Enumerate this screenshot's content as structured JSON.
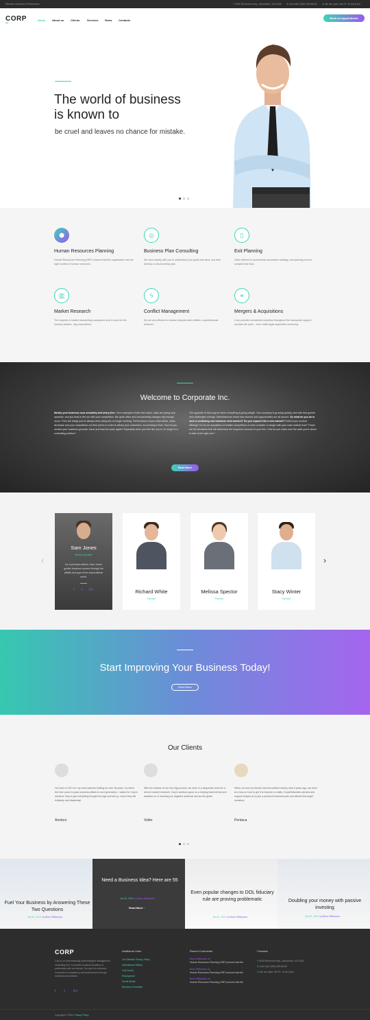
{
  "topbar": {
    "tagline": "Effective Business Performance",
    "address": "9026 Richmond Hwy., Alexandria, VA 22302",
    "phone": "Let's talk: (954) 399-86-82",
    "hours": "We are open:  Mn-Fr: 10 am-8 pm"
  },
  "nav": {
    "logo": "CORP",
    "items": [
      "Home",
      "About us",
      "Clients",
      "Services",
      "News",
      "Contacts"
    ],
    "cta": "Book an Appointment"
  },
  "hero": {
    "title_line1": "The world of business",
    "title_line2": "is known to",
    "subtitle": "be cruel and leaves no chance for mistake."
  },
  "services": [
    {
      "title": "Human Resources Planning",
      "text": "Human Resources Planning (HRP) ensures that the organization has the right number of human resources.",
      "icon": "network-icon"
    },
    {
      "title": "Business Plan Consulting",
      "text": "We work closely with you to understand your goals and aims, and then develop a new business plan.",
      "icon": "target-icon"
    },
    {
      "title": "Exit Planning",
      "text": "Often referred to as business succession strategy, exit planning is more complex than that.",
      "icon": "door-icon"
    },
    {
      "title": "Market Research",
      "text": "The majority of market researching companies tend to work for the industry leaders - big corporations.",
      "icon": "chart-icon"
    },
    {
      "title": "Conflict Management",
      "text": "It's not very efficient to resolve disputes with childish, unprofessional behavior.",
      "icon": "bolt-icon"
    },
    {
      "title": "Mergers & Acquisitions",
      "text": "Corp provides unmatched expertise throughout the transaction support services life cycle – from initial target acquisition screening.",
      "icon": "merge-icon"
    }
  ],
  "welcome": {
    "title": "Welcome to Corporate Inc.",
    "col1_bold": "Mostly your business runs smoothly and worry-free.",
    "col1": " Your employees finish their tasks, sales are going only upwards, and you lead in the run with your competition. But quite often and unexpectedly changes big enough occur. Then the things you've always been doing are no longer working. Performance of your team fades, sales decrease and your competitors cut their prices in order to attract your customers, succeeding in that. How do you reclaim your business grounds, focus and lead the pack again? Especially when you feel like you're no longer in a controlling position?",
    "col2a": "The opposite of that may be when everything is going alright. Your company is growing quickly, and with that growth new challenges emerge. Miscellaneous brand new choices and opportunities are all around. ",
    "col2_bold": "So what do you do in such a confusing new business environment? Do you expand into a new market?",
    "col2b": " Extend your product offering? Go for an acquisition of smaller competitors or even consider a merger with your main market rival? These are the decisions that will determine the long-term success of your firm. How do you make sure the path you're about to take is the right one?",
    "button": "Read More"
  },
  "team": {
    "members": [
      {
        "name": "Sam Jones",
        "role": "Senior partner",
        "bio": "As a principal advisor, Sam Jones guides business owners through the pitfalls and joys of the corporational world."
      },
      {
        "name": "Richard White",
        "role": "Partner"
      },
      {
        "name": "Melissa Spector",
        "role": "Partner"
      },
      {
        "name": "Stacy Winter",
        "role": "Partner"
      }
    ],
    "social": [
      "f",
      "t",
      "G+"
    ]
  },
  "banner": {
    "title": "Start Improving Your Business Today!",
    "button": "Read More"
  },
  "clients": {
    "title": "Our Clients",
    "items": [
      {
        "name": "Anotoro",
        "text": "I've been a CEO for my multi-national holding for over 48 years. So when the time came to pass business affairs to next generation, I asked for Corp's advisors' help to get everything thought through and set up, which they did brilliantly and flawlessly!"
      },
      {
        "name": "Volter",
        "text": "With the release of our new big product, we were in a desperate need for a decent market research. Corp's advisors gave us a helping hand at that and assisted us in reaching our targeted audience across the globe."
      },
      {
        "name": "Pentaca",
        "text": "When me and my friends had this brilliant startup idea 5 years ago, we were at a loss on how to get it to become a reality. CorpsRational's advices and support helped us to join a profound business plan and attract first angel investors."
      }
    ]
  },
  "blog": [
    {
      "title": "Fuel Your Business by Answering These Two Questions",
      "date": "Jan 20, 2016",
      "by": "by Brian Williamson"
    },
    {
      "title": "Need a Business Idea? Here are 55",
      "date": "Jan 20, 2016",
      "by": "by Brian Williamson",
      "more": "Read More"
    },
    {
      "title": "Even popular changes to DOL fiduciary rule are proving problematic",
      "date": "Jan 20, 2016",
      "by": "by Brian Williamson"
    },
    {
      "title": "Doubling your money with passive investing",
      "date": "Jan 20, 2016",
      "by": "by Brian Williamson"
    }
  ],
  "footer": {
    "logo": "CORP",
    "about": "Corp is an internationally acknowledged management consulting firm. It provides localized solutions in partnership with our clients. Our aim is to enhance Corporate's competency and performance through result-based solutions.",
    "links_title": "Additional Links",
    "links": [
      "Our Website Privacy Policy",
      "International Offices",
      "Call Centre",
      "Employment",
      "Social Media",
      "Business Promotion"
    ],
    "comments_title": "Recent Comments",
    "comments": [
      {
        "author": "Brian Williamson on",
        "text": "Human Resources Planning (HRP) ensures that the"
      },
      {
        "author": "Brian Williamson on",
        "text": "Human Resources Planning (HRP) ensures that the"
      },
      {
        "author": "Brian Williamson on",
        "text": "Human Resources Planning (HRP) ensures that the"
      }
    ],
    "contacts_title": "Contacts",
    "contacts": [
      "9026 Richmond Hwy., Alexandria, VA 22302",
      "Let's Call: (954) 399-86-82",
      "We are open:  Mn-Fr: 10 am-8 pm"
    ],
    "copyright": "Copyright © 2016.",
    "privacy": "Privacy Policy"
  },
  "colors": {
    "accent_teal": "#3fd3b6",
    "accent_purple": "#9b59f0",
    "dark": "#2d2d2d"
  }
}
